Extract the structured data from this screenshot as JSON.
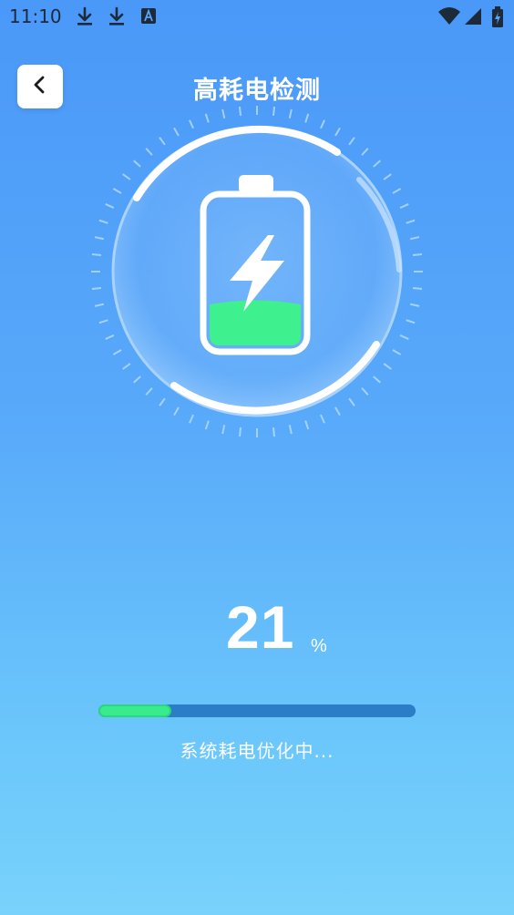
{
  "status_bar": {
    "time": "11:10",
    "icons": [
      "download-icon",
      "download-icon",
      "text-a-icon",
      "wifi-icon",
      "signal-icon",
      "battery-charging-icon"
    ]
  },
  "header": {
    "title": "高耗电检测",
    "back_icon": "chevron-left-icon"
  },
  "gauge": {
    "icon": "battery-charging-icon",
    "battery_fill_color": "#3ff08e"
  },
  "progress": {
    "percent_value": "21",
    "percent_unit": "%",
    "fraction": 0.23,
    "status_text": "系统耗电优化中..."
  },
  "colors": {
    "accent_green": "#38ec8d",
    "track": "#2b7dc8",
    "background_top": "#4a98f8",
    "background_bottom": "#78d2fb"
  }
}
